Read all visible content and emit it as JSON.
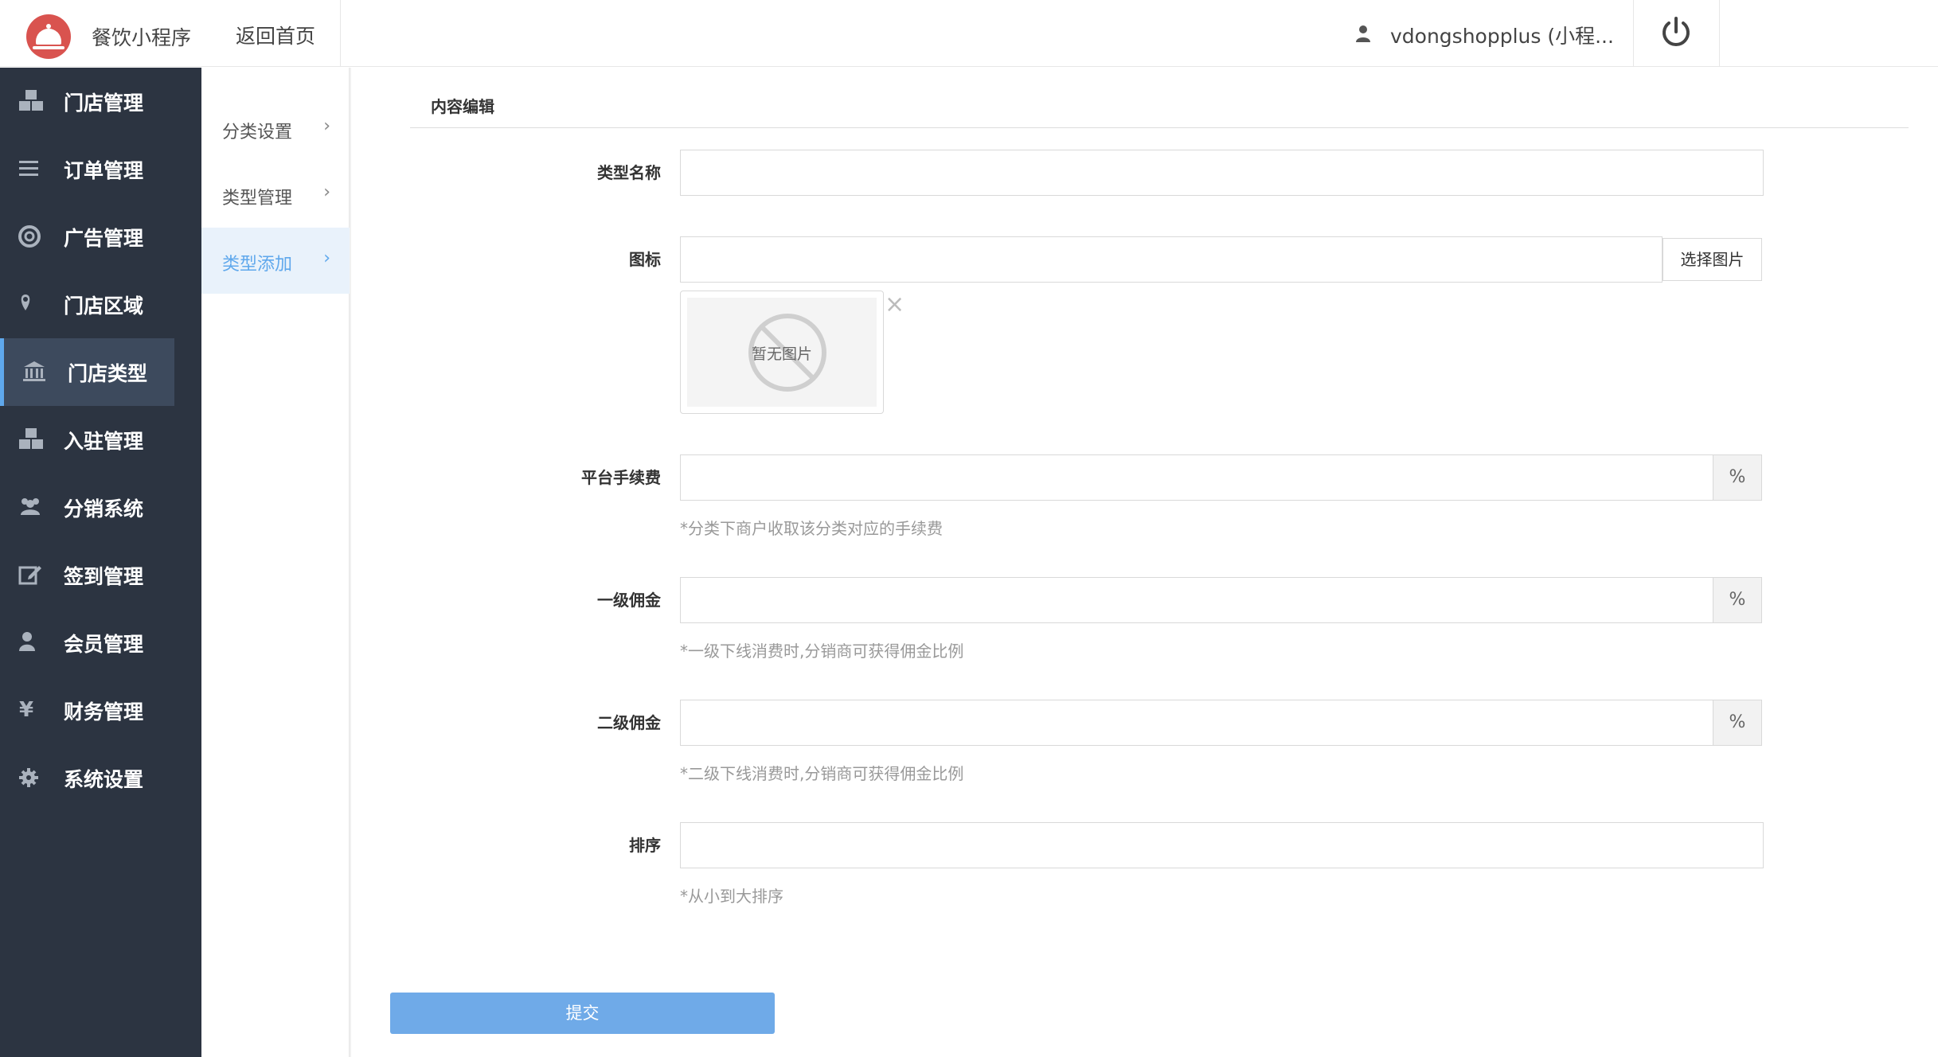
{
  "header": {
    "app_title": "餐饮小程序",
    "home_link": "返回首页",
    "user_name": "vdongshopplus (小程...",
    "logo_color": "#d9534f"
  },
  "sidebar": {
    "background": "#2c3441",
    "accent": "#5fa8ec",
    "items": [
      {
        "label": "门店管理",
        "icon": "cubes-icon"
      },
      {
        "label": "订单管理",
        "icon": "list-icon"
      },
      {
        "label": "广告管理",
        "icon": "lifebuoy-icon"
      },
      {
        "label": "门店区域",
        "icon": "map-pin-icon"
      },
      {
        "label": "门店类型",
        "icon": "bank-icon",
        "active": true
      },
      {
        "label": "入驻管理",
        "icon": "cubes-icon"
      },
      {
        "label": "分销系统",
        "icon": "users-icon"
      },
      {
        "label": "签到管理",
        "icon": "edit-icon"
      },
      {
        "label": "会员管理",
        "icon": "user-icon"
      },
      {
        "label": "财务管理",
        "icon": "yen-icon"
      },
      {
        "label": "系统设置",
        "icon": "gear-icon"
      }
    ]
  },
  "subnav": {
    "items": [
      {
        "label": "分类设置"
      },
      {
        "label": "类型管理"
      },
      {
        "label": "类型添加",
        "active": true
      }
    ],
    "chevron": "›"
  },
  "content": {
    "title": "内容编辑",
    "fields": {
      "type_name": {
        "label": "类型名称",
        "value": ""
      },
      "icon": {
        "label": "图标",
        "value": "",
        "button": "选择图片",
        "no_image": "暂无图片",
        "remove": "×"
      },
      "platform_fee": {
        "label": "平台手续费",
        "value": "",
        "addon": "%",
        "help": "*分类下商户收取该分类对应的手续费"
      },
      "level1": {
        "label": "一级佣金",
        "value": "",
        "addon": "%",
        "help": "*一级下线消费时,分销商可获得佣金比例"
      },
      "level2": {
        "label": "二级佣金",
        "value": "",
        "addon": "%",
        "help": "*二级下线消费时,分销商可获得佣金比例"
      },
      "sort": {
        "label": "排序",
        "value": "",
        "help": "*从小到大排序"
      }
    },
    "submit": "提交"
  }
}
